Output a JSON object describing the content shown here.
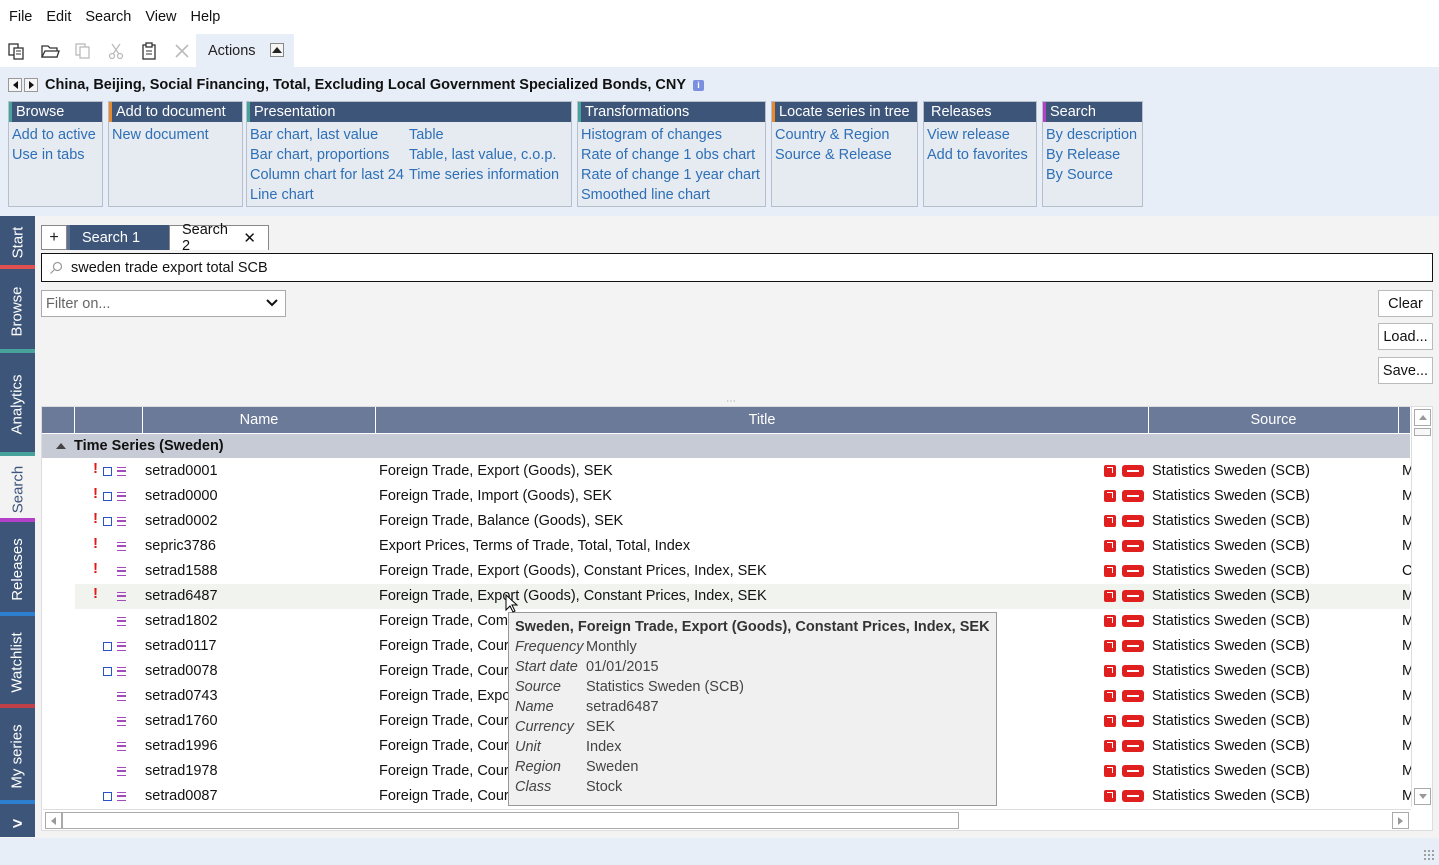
{
  "menu": [
    "File",
    "Edit",
    "Search",
    "View",
    "Help"
  ],
  "toolbar": {
    "icons": [
      "new-copy-icon",
      "open-folder-icon",
      "copy-icon",
      "cut-icon",
      "paste-icon",
      "delete-icon"
    ],
    "actions_label": "Actions"
  },
  "series_title": "China, Beijing, Social Financing, Total, Excluding Local Government Specialized Bonds, CNY",
  "action_groups": [
    {
      "name": "Browse",
      "accent": "#48a39d",
      "cols": [
        [
          "Add to active",
          "Use in tabs"
        ]
      ]
    },
    {
      "name": "Add to document",
      "accent": "#e88a2c",
      "cols": [
        [
          "New document"
        ]
      ]
    },
    {
      "name": "Presentation",
      "accent": "#48a39d",
      "cols": [
        [
          "Bar chart, last value",
          "Bar chart, proportions",
          "Column chart for last 24",
          "Line chart"
        ],
        [
          "Table",
          "Table, last value, c.o.p.",
          "Time series information"
        ]
      ]
    },
    {
      "name": "Transformations",
      "accent": "#48a39d",
      "cols": [
        [
          "Histogram of changes",
          "Rate of change 1 obs chart",
          "Rate of change 1 year chart",
          "Smoothed line chart"
        ]
      ]
    },
    {
      "name": "Locate series in tree",
      "accent": "#e88a2c",
      "cols": [
        [
          "Country & Region",
          "Source & Release"
        ]
      ]
    },
    {
      "name": "Releases",
      "accent": "#3d5579",
      "cols": [
        [
          "View release",
          "Add to favorites"
        ]
      ]
    },
    {
      "name": "Search",
      "accent": "#b43fc8",
      "cols": [
        [
          "By description",
          "By Release",
          "By Source"
        ]
      ]
    }
  ],
  "side_tabs": [
    {
      "label": "Start",
      "bar": "#e05050"
    },
    {
      "label": "Browse",
      "bar": "#48a39d"
    },
    {
      "label": "Analytics",
      "bar": "#48a39d"
    },
    {
      "label": "Search",
      "bar": "#b43fc8",
      "active": true
    },
    {
      "label": "Releases",
      "bar": "#2d7fd0"
    },
    {
      "label": "Watchlist",
      "bar": "#c0404a"
    },
    {
      "label": "My series",
      "bar": "#2d7fd0"
    }
  ],
  "side_more": ">",
  "search_tabs": {
    "plus": "+",
    "tabs": [
      "Search 1",
      "Search 2"
    ],
    "close": "✕"
  },
  "search": {
    "value": "sweden trade export total SCB"
  },
  "filter": {
    "placeholder": "Filter on..."
  },
  "buttons": {
    "clear": "Clear",
    "load": "Load...",
    "save": "Save..."
  },
  "grid": {
    "headers": {
      "name": "Name",
      "title": "Title",
      "source": "Source"
    },
    "group": "Time Series (Sweden)",
    "rows": [
      {
        "flag": true,
        "sq": true,
        "name": "setrad0001",
        "title": "Foreign Trade, Export (Goods), SEK",
        "source": "Statistics Sweden (SCB)",
        "extra": "M"
      },
      {
        "flag": true,
        "sq": true,
        "name": "setrad0000",
        "title": "Foreign Trade, Import (Goods), SEK",
        "source": "Statistics Sweden (SCB)",
        "extra": "M"
      },
      {
        "flag": true,
        "sq": true,
        "name": "setrad0002",
        "title": "Foreign Trade, Balance (Goods), SEK",
        "source": "Statistics Sweden (SCB)",
        "extra": "M"
      },
      {
        "flag": true,
        "sq": false,
        "name": "sepric3786",
        "title": "Export Prices, Terms of Trade, Total, Total, Index",
        "source": "Statistics Sweden (SCB)",
        "extra": "M"
      },
      {
        "flag": true,
        "sq": false,
        "name": "setrad1588",
        "title": "Foreign Trade, Export (Goods), Constant Prices, Index, SEK",
        "source": "Statistics Sweden (SCB)",
        "extra": "C"
      },
      {
        "flag": true,
        "sq": false,
        "name": "setrad6487",
        "title": "Foreign Trade, Export (Goods), Constant Prices, Index, SEK",
        "source": "Statistics Sweden (SCB)",
        "extra": "M",
        "hover": true
      },
      {
        "flag": false,
        "sq": false,
        "name": "setrad1802",
        "title": "Foreign Trade, Com",
        "source": "Statistics Sweden (SCB)",
        "extra": "M"
      },
      {
        "flag": false,
        "sq": true,
        "name": "setrad0117",
        "title": "Foreign Trade, Cour",
        "source": "Statistics Sweden (SCB)",
        "extra": "M"
      },
      {
        "flag": false,
        "sq": true,
        "name": "setrad0078",
        "title": "Foreign Trade, Cour",
        "source": "Statistics Sweden (SCB)",
        "extra": "M"
      },
      {
        "flag": false,
        "sq": false,
        "name": "setrad0743",
        "title": "Foreign Trade, Expo",
        "source": "Statistics Sweden (SCB)",
        "extra": "M"
      },
      {
        "flag": false,
        "sq": false,
        "name": "setrad1760",
        "title": "Foreign Trade, Cour",
        "source": "Statistics Sweden (SCB)",
        "extra": "M"
      },
      {
        "flag": false,
        "sq": false,
        "name": "setrad1996",
        "title": "Foreign Trade, Cour",
        "source": "Statistics Sweden (SCB)",
        "extra": "M"
      },
      {
        "flag": false,
        "sq": false,
        "name": "setrad1978",
        "title": "Foreign Trade, Cour",
        "source": "Statistics Sweden (SCB)",
        "extra": "M"
      },
      {
        "flag": false,
        "sq": true,
        "name": "setrad0087",
        "title": "Foreign Trade, Cour",
        "source": "Statistics Sweden (SCB)",
        "extra": "M"
      }
    ]
  },
  "tooltip": {
    "title": "Sweden, Foreign Trade, Export (Goods), Constant Prices, Index, SEK",
    "fields": [
      {
        "k": "Frequency",
        "v": "Monthly"
      },
      {
        "k": "Start date",
        "v": "01/01/2015"
      },
      {
        "k": "Source",
        "v": "Statistics Sweden (SCB)"
      },
      {
        "k": "Name",
        "v": "setrad6487"
      },
      {
        "k": "Currency",
        "v": "SEK"
      },
      {
        "k": "Unit",
        "v": "Index"
      },
      {
        "k": "Region",
        "v": "Sweden"
      },
      {
        "k": "Class",
        "v": "Stock"
      }
    ]
  }
}
